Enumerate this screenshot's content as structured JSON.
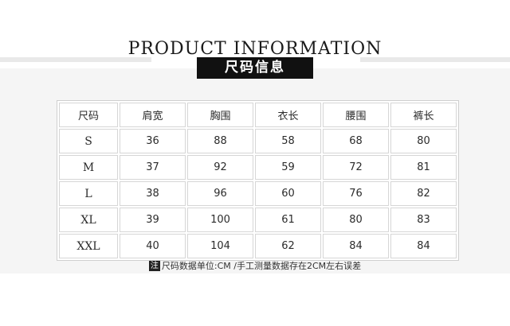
{
  "header": {
    "title": "PRODUCT INFORMATION",
    "subtitle": "尺码信息"
  },
  "table": {
    "headers": [
      "尺码",
      "肩宽",
      "胸围",
      "衣长",
      "腰围",
      "裤长"
    ],
    "rows": [
      [
        "S",
        "36",
        "88",
        "58",
        "68",
        "80"
      ],
      [
        "M",
        "37",
        "92",
        "59",
        "72",
        "81"
      ],
      [
        "L",
        "38",
        "96",
        "60",
        "76",
        "82"
      ],
      [
        "XL",
        "39",
        "100",
        "61",
        "80",
        "83"
      ],
      [
        "XXL",
        "40",
        "104",
        "62",
        "84",
        "84"
      ]
    ]
  },
  "note": {
    "mark": "注",
    "text": "尺码数据单位:CM /手工测量数据存在2CM左右误差"
  }
}
